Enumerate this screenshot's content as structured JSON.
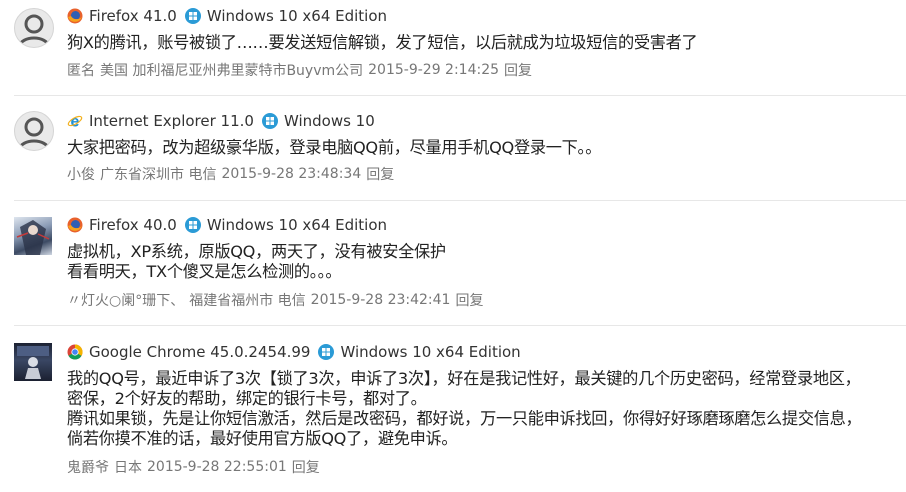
{
  "comments": [
    {
      "browser": "Firefox 41.0",
      "browser_icon": "firefox-icon",
      "os": "Windows 10 x64 Edition",
      "os_icon": "windows-icon",
      "lines": [
        "狗X的腾讯，账号被锁了……要发送短信解锁，发了短信，以后就成为垃圾短信的受害者了"
      ],
      "author": "匿名",
      "location": "美国 加利福尼亚州弗里蒙特市Buyvm公司",
      "time": "2015-9-29 2:14:25",
      "reply": "回复"
    },
    {
      "browser": "Internet Explorer 11.0",
      "browser_icon": "internet-explorer-icon",
      "os": "Windows 10",
      "os_icon": "windows-icon",
      "lines": [
        "大家把密码，改为超级豪华版，登录电脑QQ前，尽量用手机QQ登录一下。。"
      ],
      "author": "小俊",
      "location": "广东省深圳市 电信",
      "time": "2015-9-28 23:48:34",
      "reply": "回复"
    },
    {
      "browser": "Firefox 40.0",
      "browser_icon": "firefox-icon",
      "os": "Windows 10 x64 Edition",
      "os_icon": "windows-icon",
      "lines": [
        "虚拟机，XP系统，原版QQ，两天了，没有被安全保护",
        "看看明天，TX个傻叉是怎么检测的。。。"
      ],
      "author": "〃灯火○阑°珊下、",
      "location": "福建省福州市 电信",
      "time": "2015-9-28 23:42:41",
      "reply": "回复"
    },
    {
      "browser": "Google Chrome 45.0.2454.99",
      "browser_icon": "chrome-icon",
      "os": "Windows 10 x64 Edition",
      "os_icon": "windows-icon",
      "lines": [
        "我的QQ号，最近申诉了3次【锁了3次，申诉了3次】，好在是我记性好，最关键的几个历史密码，经常登录地区，",
        "密保，2个好友的帮助，绑定的银行卡号，都对了。",
        "腾讯如果锁，先是让你短信激活，然后是改密码，都好说，万一只能申诉找回，你得好好琢磨琢磨怎么提交信息，",
        "倘若你摸不准的话，最好使用官方版QQ了，避免申诉。"
      ],
      "author": "鬼爵爷",
      "location": "日本",
      "time": "2015-9-28 22:55:01",
      "reply": "回复"
    }
  ]
}
